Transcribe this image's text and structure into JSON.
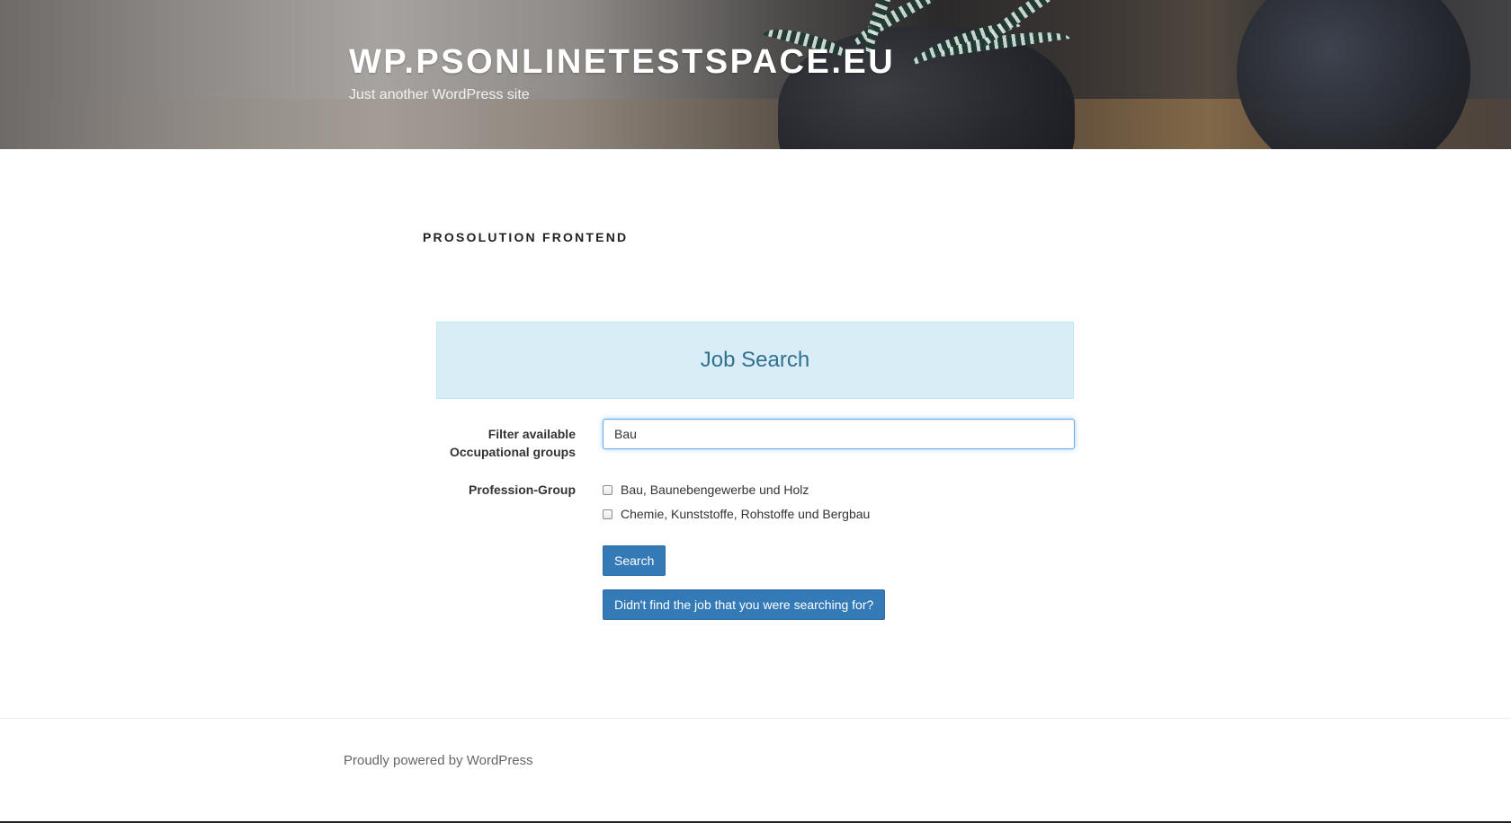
{
  "header": {
    "site_title": "WP.PSONLINETESTSPACE.EU",
    "tagline": "Just another WordPress site"
  },
  "page": {
    "title": "PROSOLUTION FRONTEND"
  },
  "job_search": {
    "heading": "Job Search",
    "filter_label": "Filter available Occupational groups",
    "filter_value": "Bau",
    "profession_group_label": "Profession-Group",
    "profession_groups": [
      {
        "label": "Bau, Baunebengewerbe und Holz",
        "checked": false
      },
      {
        "label": "Chemie, Kunststoffe, Rohstoffe und Bergbau",
        "checked": false
      }
    ],
    "search_button": "Search",
    "not_found_button": "Didn't find the job that you were searching for?"
  },
  "footer": {
    "text": "Proudly powered by WordPress"
  },
  "colors": {
    "panel_bg": "#d9edf7",
    "panel_text": "#31708f",
    "button_bg": "#337ab7",
    "input_focus": "#66afe9"
  }
}
